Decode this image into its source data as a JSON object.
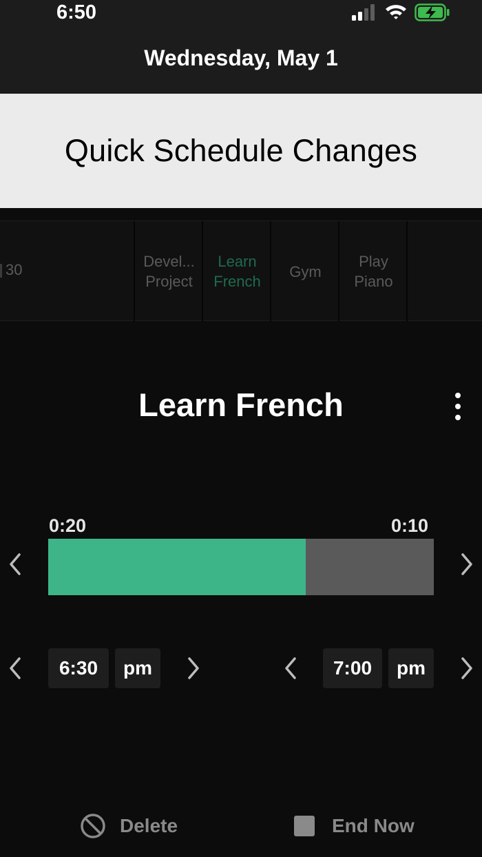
{
  "status_bar": {
    "time": "6:50",
    "signal_icon": "cellular-signal-icon",
    "wifi_icon": "wifi-icon",
    "battery_icon": "battery-charging-icon"
  },
  "header": {
    "date": "Wednesday, May 1"
  },
  "banner": {
    "title": "Quick Schedule Changes"
  },
  "schedule_strip": {
    "partial_item": "30",
    "items": [
      {
        "line1": "Devel...",
        "line2": "Project",
        "active": false
      },
      {
        "line1": "Learn",
        "line2": "French",
        "active": true
      },
      {
        "line1": "Gym",
        "line2": "",
        "active": false
      },
      {
        "line1": "Play",
        "line2": "Piano",
        "active": false
      }
    ]
  },
  "task": {
    "title": "Learn French",
    "elapsed": "0:20",
    "remaining": "0:10",
    "progress_fraction": 0.667,
    "start_time": "6:30",
    "start_period": "pm",
    "end_time": "7:00",
    "end_period": "pm"
  },
  "actions": {
    "delete_label": "Delete",
    "end_now_label": "End Now"
  },
  "colors": {
    "accent": "#3eb489",
    "active_tab_text": "#1f6b4c",
    "remaining_bar": "#5a5a5a",
    "banner_bg": "#ebebeb",
    "header_bg": "#1c1c1c",
    "background": "#0c0c0c"
  }
}
